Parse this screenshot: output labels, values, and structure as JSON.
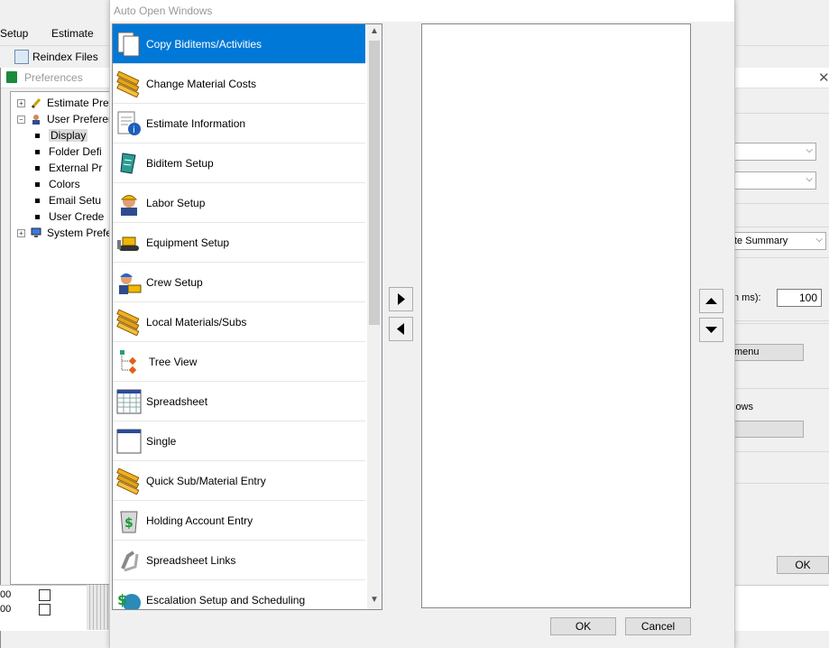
{
  "app_menu": [
    "Setup",
    "Estimate"
  ],
  "toolbar": {
    "reindex_label": "Reindex Files"
  },
  "preferences": {
    "title": "Preferences",
    "tree": [
      {
        "label": "Estimate Prefe",
        "icon": "pencil-icon",
        "level": 0,
        "expander": "+"
      },
      {
        "label": "User Preferen",
        "icon": "user-icon",
        "level": 0,
        "expander": "−"
      },
      {
        "label": "Display",
        "level": 1,
        "selected": true
      },
      {
        "label": "Folder Defi",
        "level": 1
      },
      {
        "label": "External Pr",
        "level": 1
      },
      {
        "label": "Colors",
        "level": 1
      },
      {
        "label": "Email Setu",
        "level": 1
      },
      {
        "label": "User Crede",
        "level": 1
      },
      {
        "label": "System Prefer",
        "icon": "monitor-icon",
        "level": 0,
        "expander": "+"
      }
    ],
    "right_panel": {
      "combo3_value": "te Summary",
      "ms_label": "n ms):",
      "ms_value": "100",
      "menu_button": "menu",
      "windows_label": "lows",
      "ok_label": "OK"
    },
    "grid_rows": [
      "00",
      "00"
    ]
  },
  "dialog": {
    "title": "Auto Open Windows",
    "available_items": [
      {
        "label": "Copy Biditems/Activities",
        "icon": "copy-pages-icon",
        "selected": true
      },
      {
        "label": "Change Material Costs",
        "icon": "pipes-icon"
      },
      {
        "label": "Estimate Information",
        "icon": "document-info-icon"
      },
      {
        "label": "Biditem Setup",
        "icon": "scroll-icon"
      },
      {
        "label": "Labor Setup",
        "icon": "worker-icon"
      },
      {
        "label": "Equipment Setup",
        "icon": "bulldozer-icon"
      },
      {
        "label": "Crew Setup",
        "icon": "crew-icon"
      },
      {
        "label": "Local Materials/Subs",
        "icon": "pipes-icon"
      },
      {
        "label": "Tree View",
        "icon": "tree-view-icon"
      },
      {
        "label": "Spreadsheet",
        "icon": "spreadsheet-icon"
      },
      {
        "label": "Single",
        "icon": "single-window-icon"
      },
      {
        "label": "Quick Sub/Material Entry",
        "icon": "pipes-icon"
      },
      {
        "label": "Holding Account Entry",
        "icon": "money-bin-icon"
      },
      {
        "label": "Spreadsheet Links",
        "icon": "link-icon"
      },
      {
        "label": "Escalation Setup and Scheduling",
        "icon": "escalation-icon"
      }
    ],
    "ok_label": "OK",
    "cancel_label": "Cancel"
  },
  "colors": {
    "selection": "#0078d7",
    "accent_green": "#1a8a3c"
  }
}
